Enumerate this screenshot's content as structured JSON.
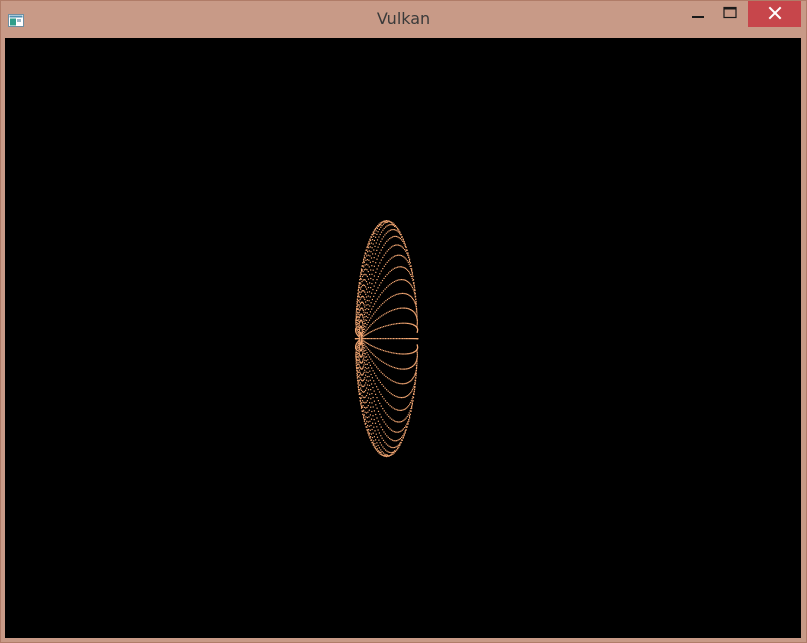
{
  "window": {
    "title": "Vulkan",
    "app_icon": "window-app-icon",
    "controls": {
      "minimize_icon": "minimize-icon",
      "maximize_icon": "maximize-icon",
      "close_icon": "close-icon"
    }
  },
  "render": {
    "background_color": "#000000",
    "point_color": "#f2a672",
    "shape": "point-cloud-sphere"
  },
  "colors": {
    "frame": "#c89a87",
    "close_button": "#c7464b"
  }
}
